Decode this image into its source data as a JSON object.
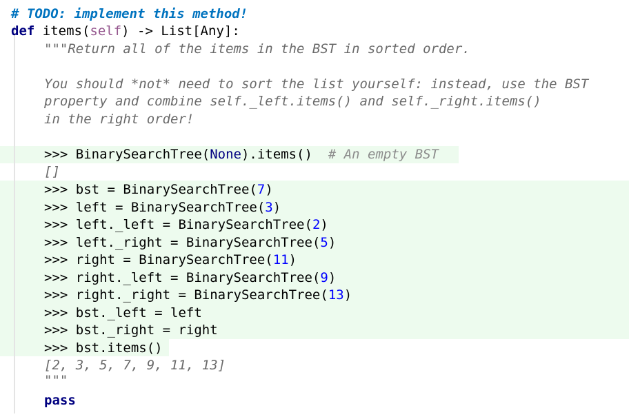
{
  "editor": {
    "todo_comment": "# TODO: implement this method!",
    "signature": {
      "def_kw": "def",
      "name": " items(",
      "self": "self",
      "rest": ") -> List[Any]:"
    },
    "docstring_lines": [
      "\"\"\"Return all of the items in the BST in sorted order.",
      "You should *not* need to sort the list yourself: instead, use the BST",
      "property and combine self._left.items() and self._right.items()",
      "in the right order!"
    ],
    "doctest_empty": {
      "prefix": ">>> BinarySearchTree(",
      "none": "None",
      "suffix": ").items()  ",
      "comment": "# An empty BST",
      "output": "[]"
    },
    "doctest_lines": [
      {
        "code": ">>> bst = BinarySearchTree(",
        "num": "7",
        "end": ")"
      },
      {
        "code": ">>> left = BinarySearchTree(",
        "num": "3",
        "end": ")"
      },
      {
        "code": ">>> left._left = BinarySearchTree(",
        "num": "2",
        "end": ")"
      },
      {
        "code": ">>> left._right = BinarySearchTree(",
        "num": "5",
        "end": ")"
      },
      {
        "code": ">>> right = BinarySearchTree(",
        "num": "11",
        "end": ")"
      },
      {
        "code": ">>> right._left = BinarySearchTree(",
        "num": "9",
        "end": ")"
      },
      {
        "code": ">>> right._right = BinarySearchTree(",
        "num": "13",
        "end": ")"
      },
      {
        "code": ">>> bst._left = left",
        "num": "",
        "end": ""
      },
      {
        "code": ">>> bst._right = right",
        "num": "",
        "end": ""
      },
      {
        "code": ">>> bst.items()",
        "num": "",
        "end": ""
      }
    ],
    "doctest_output": "[2, 3, 5, 7, 9, 11, 13]",
    "docstring_close": "\"\"\"",
    "pass_kw": "pass"
  }
}
